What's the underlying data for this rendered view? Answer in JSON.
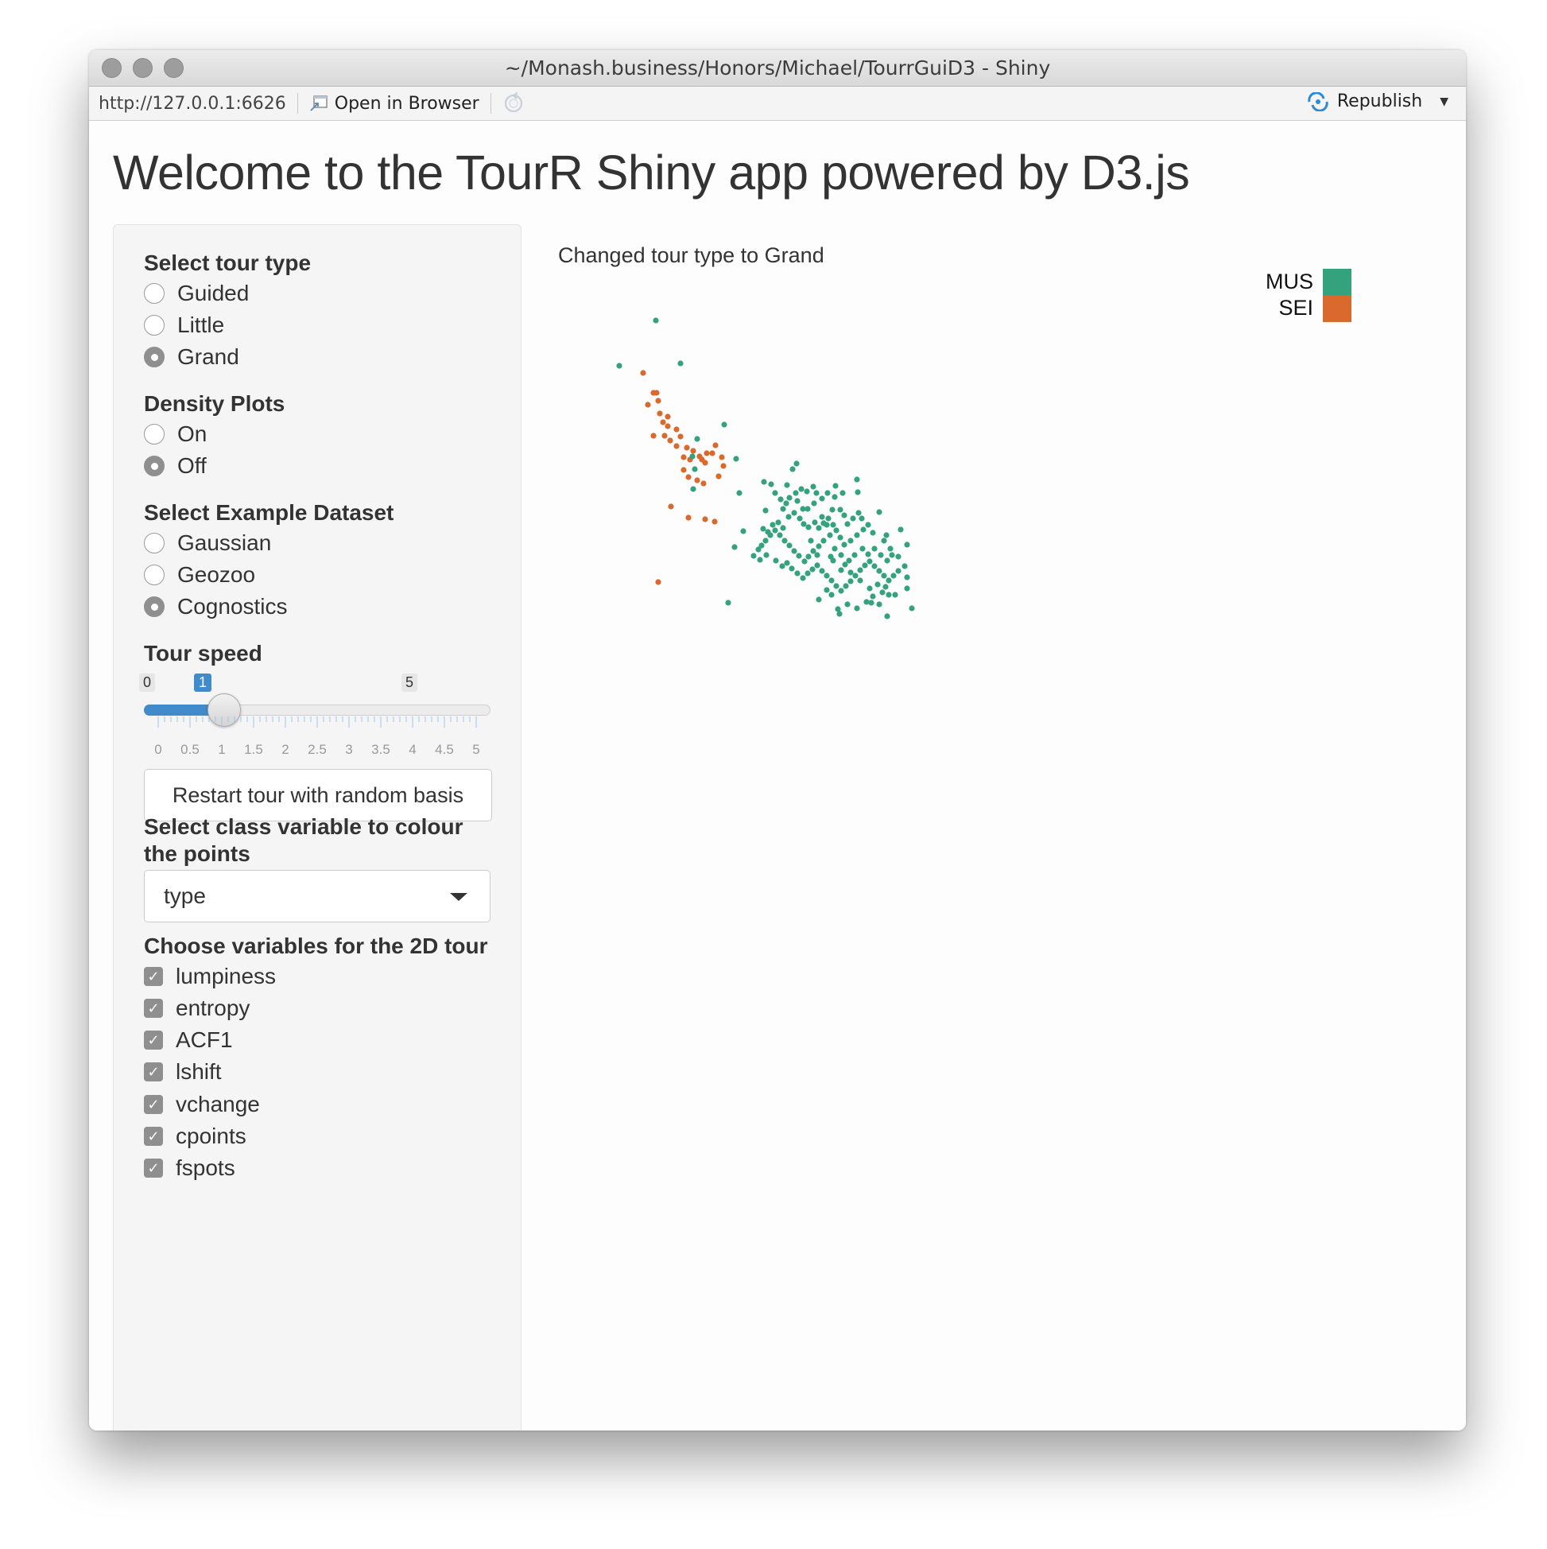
{
  "window": {
    "title": "~/Monash.business/Honors/Michael/TourrGuiD3 - Shiny"
  },
  "toolbar": {
    "url": "http://127.0.0.1:6626",
    "open_browser": "Open in Browser",
    "republish": "Republish"
  },
  "page": {
    "title": "Welcome to the TourR Shiny app powered by D3.js"
  },
  "sidebar": {
    "tour_type": {
      "label": "Select tour type",
      "options": [
        "Guided",
        "Little",
        "Grand"
      ],
      "selected": "Grand"
    },
    "density": {
      "label": "Density Plots",
      "options": [
        "On",
        "Off"
      ],
      "selected": "Off"
    },
    "dataset": {
      "label": "Select Example Dataset",
      "options": [
        "Gaussian",
        "Geozoo",
        "Cognostics"
      ],
      "selected": "Cognostics"
    },
    "speed": {
      "label": "Tour speed",
      "min": "0",
      "max": "5",
      "value": "1",
      "tick_labels": [
        "0",
        "0.5",
        "1",
        "1.5",
        "2",
        "2.5",
        "3",
        "3.5",
        "4",
        "4.5",
        "5"
      ]
    },
    "restart_button": "Restart tour with random basis",
    "class_var": {
      "label": "Select class variable to colour the points",
      "selected": "type"
    },
    "vars": {
      "label": "Choose variables for the 2D tour",
      "items": [
        "lumpiness",
        "entropy",
        "ACF1",
        "lshift",
        "vchange",
        "cpoints",
        "fspots"
      ],
      "checked": "✓"
    }
  },
  "main": {
    "status": "Changed tour type to Grand"
  },
  "colors": {
    "MUS": "#35a27e",
    "SEI": "#d9692d"
  },
  "chart_data": {
    "type": "scatter",
    "legend": [
      {
        "name": "MUS",
        "color": "#35a27e"
      },
      {
        "name": "SEI",
        "color": "#d9692d"
      }
    ],
    "series": [
      {
        "name": "SEI",
        "points": [
          [
            809,
            469
          ],
          [
            822,
            494
          ],
          [
            826,
            494
          ],
          [
            815,
            509
          ],
          [
            828,
            504
          ],
          [
            830,
            520
          ],
          [
            840,
            524
          ],
          [
            834,
            531
          ],
          [
            840,
            536
          ],
          [
            851,
            540
          ],
          [
            822,
            548
          ],
          [
            836,
            548
          ],
          [
            843,
            554
          ],
          [
            856,
            549
          ],
          [
            851,
            561
          ],
          [
            864,
            563
          ],
          [
            872,
            567
          ],
          [
            860,
            575
          ],
          [
            868,
            578
          ],
          [
            883,
            578
          ],
          [
            889,
            570
          ],
          [
            896,
            570
          ],
          [
            900,
            560
          ],
          [
            908,
            575
          ],
          [
            910,
            586
          ],
          [
            887,
            582
          ],
          [
            880,
            574
          ],
          [
            860,
            591
          ],
          [
            866,
            600
          ],
          [
            877,
            604
          ],
          [
            885,
            608
          ],
          [
            904,
            599
          ],
          [
            844,
            637
          ],
          [
            866,
            651
          ],
          [
            887,
            653
          ],
          [
            899,
            656
          ],
          [
            828,
            732
          ]
        ]
      },
      {
        "name": "MUS",
        "points": [
          [
            825,
            403
          ],
          [
            779,
            460
          ],
          [
            856,
            457
          ],
          [
            911,
            534
          ],
          [
            926,
            577
          ],
          [
            877,
            552
          ],
          [
            871,
            574
          ],
          [
            874,
            590
          ],
          [
            872,
            615
          ],
          [
            930,
            620
          ],
          [
            1002,
            583
          ],
          [
            997,
            590
          ],
          [
            990,
            610
          ],
          [
            961,
            606
          ],
          [
            970,
            609
          ],
          [
            975,
            620
          ],
          [
            982,
            628
          ],
          [
            989,
            633
          ],
          [
            963,
            642
          ],
          [
            1001,
            620
          ],
          [
            1008,
            615
          ],
          [
            1015,
            618
          ],
          [
            1023,
            612
          ],
          [
            1027,
            620
          ],
          [
            1034,
            627
          ],
          [
            1041,
            620
          ],
          [
            1051,
            611
          ],
          [
            1060,
            620
          ],
          [
            1078,
            603
          ],
          [
            1047,
            641
          ],
          [
            1057,
            641
          ],
          [
            1062,
            648
          ],
          [
            1066,
            659
          ],
          [
            1073,
            652
          ],
          [
            1079,
            619
          ],
          [
            1080,
            645
          ],
          [
            1106,
            644
          ],
          [
            1098,
            670
          ],
          [
            1115,
            673
          ],
          [
            1133,
            666
          ],
          [
            1141,
            685
          ],
          [
            960,
            665
          ],
          [
            966,
            669
          ],
          [
            972,
            660
          ],
          [
            979,
            657
          ],
          [
            985,
            664
          ],
          [
            992,
            650
          ],
          [
            999,
            645
          ],
          [
            1006,
            652
          ],
          [
            1011,
            659
          ],
          [
            1017,
            663
          ],
          [
            1025,
            657
          ],
          [
            1030,
            664
          ],
          [
            1036,
            658
          ],
          [
            1042,
            652
          ],
          [
            1048,
            660
          ],
          [
            1052,
            667
          ],
          [
            1044,
            673
          ],
          [
            1036,
            680
          ],
          [
            1030,
            687
          ],
          [
            1023,
            693
          ],
          [
            1017,
            700
          ],
          [
            1012,
            706
          ],
          [
            1005,
            699
          ],
          [
            999,
            693
          ],
          [
            993,
            686
          ],
          [
            987,
            680
          ],
          [
            981,
            673
          ],
          [
            975,
            667
          ],
          [
            969,
            673
          ],
          [
            963,
            680
          ],
          [
            958,
            686
          ],
          [
            954,
            691
          ],
          [
            948,
            699
          ],
          [
            956,
            704
          ],
          [
            964,
            698
          ],
          [
            976,
            705
          ],
          [
            984,
            712
          ],
          [
            990,
            708
          ],
          [
            996,
            715
          ],
          [
            1003,
            721
          ],
          [
            1010,
            727
          ],
          [
            1016,
            721
          ],
          [
            1022,
            716
          ],
          [
            1028,
            711
          ],
          [
            1034,
            718
          ],
          [
            1040,
            724
          ],
          [
            1046,
            730
          ],
          [
            1052,
            737
          ],
          [
            1058,
            743
          ],
          [
            1064,
            737
          ],
          [
            1070,
            731
          ],
          [
            1076,
            724
          ],
          [
            1082,
            717
          ],
          [
            1088,
            711
          ],
          [
            1094,
            706
          ],
          [
            1100,
            712
          ],
          [
            1106,
            718
          ],
          [
            1112,
            724
          ],
          [
            1118,
            730
          ],
          [
            1124,
            724
          ],
          [
            1130,
            718
          ],
          [
            1138,
            712
          ],
          [
            1141,
            726
          ],
          [
            1141,
            740
          ],
          [
            1126,
            748
          ],
          [
            1118,
            748
          ],
          [
            1110,
            745
          ],
          [
            1098,
            750
          ],
          [
            1090,
            757
          ],
          [
            1078,
            765
          ],
          [
            1066,
            760
          ],
          [
            1054,
            766
          ],
          [
            1056,
            772
          ],
          [
            1046,
            748
          ],
          [
            1040,
            742
          ],
          [
            1030,
            754
          ],
          [
            1085,
            690
          ],
          [
            1092,
            697
          ],
          [
            1075,
            698
          ],
          [
            1068,
            705
          ],
          [
            1058,
            698
          ],
          [
            1050,
            690
          ],
          [
            1062,
            685
          ],
          [
            1070,
            680
          ],
          [
            1078,
            673
          ],
          [
            1086,
            666
          ],
          [
            1092,
            660
          ],
          [
            1084,
            652
          ],
          [
            1034,
            650
          ],
          [
            1040,
            660
          ],
          [
            1020,
            680
          ],
          [
            1028,
            698
          ],
          [
            1048,
            705
          ],
          [
            1058,
            717
          ],
          [
            1070,
            720
          ],
          [
            1082,
            730
          ],
          [
            1094,
            740
          ],
          [
            1104,
            735
          ],
          [
            1114,
            738
          ],
          [
            1122,
            698
          ],
          [
            1116,
            705
          ],
          [
            1108,
            698
          ],
          [
            1100,
            690
          ],
          [
            1112,
            680
          ],
          [
            1120,
            690
          ],
          [
            1130,
            700
          ],
          [
            1003,
            630
          ],
          [
            1016,
            640
          ],
          [
            1050,
            625
          ],
          [
            1024,
            633
          ],
          [
            935,
            668
          ],
          [
            924,
            688
          ],
          [
            916,
            758
          ],
          [
            1147,
            765
          ],
          [
            1116,
            775
          ],
          [
            1096,
            758
          ],
          [
            1106,
            760
          ],
          [
            985,
            640
          ],
          [
            993,
            626
          ],
          [
            1010,
            640
          ],
          [
            1063,
            710
          ],
          [
            1057,
            676
          ],
          [
            1045,
            700
          ]
        ]
      }
    ]
  }
}
